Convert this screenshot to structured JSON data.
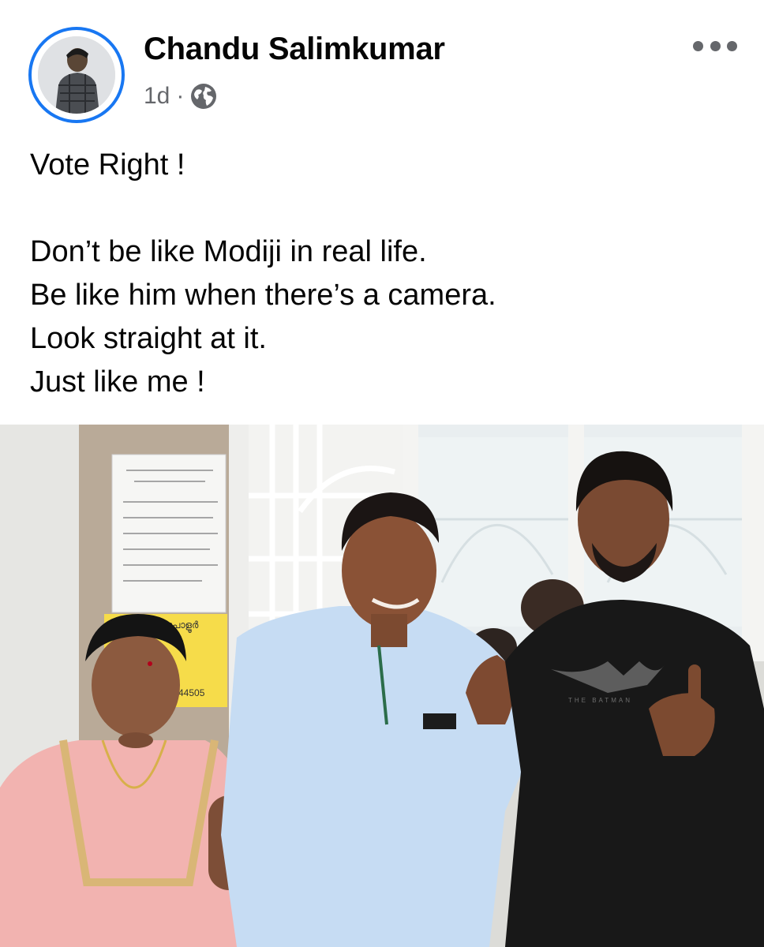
{
  "post": {
    "author": "Chandu Salimkumar",
    "timestamp": "1d",
    "separator": "·",
    "audience_icon": "globe-icon",
    "more_icon": "more-horizontal-icon",
    "text_lines": [
      "Vote Right !",
      "",
      "Don’t be like Modiji in real life.",
      "Be like him when there’s a camera.",
      "Look straight at it.",
      "Just like me !"
    ],
    "photo": {
      "notice_sign_text": "78 പോളൂർ",
      "notice_sign_number": "44505",
      "shirt_print": "THE BATMAN"
    }
  },
  "colors": {
    "accent": "#1877f2",
    "secondary_text": "#65676b",
    "primary_text": "#050505"
  }
}
